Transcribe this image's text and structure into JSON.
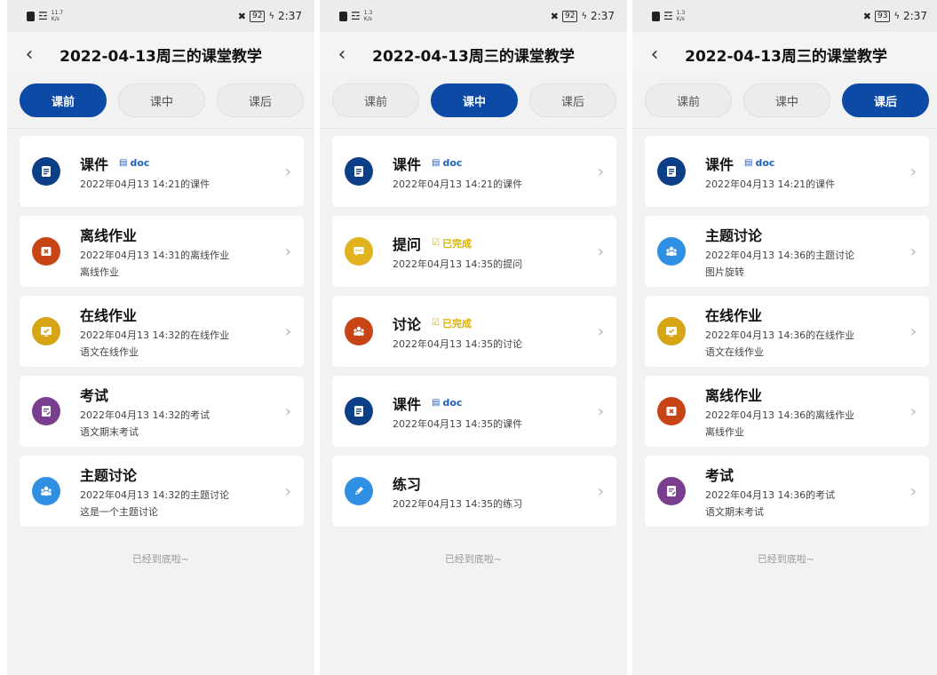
{
  "phones": [
    {
      "status": {
        "net": [
          "11.7",
          "K/s"
        ],
        "battery": "92",
        "time": "2:37"
      },
      "title": "2022-04-13周三的课堂教学",
      "tabs": [
        {
          "label": "课前",
          "active": true
        },
        {
          "label": "课中",
          "active": false
        },
        {
          "label": "课后",
          "active": false
        }
      ],
      "items": [
        {
          "title": "课件",
          "tag": "doc",
          "tag_type": "doc",
          "sub": "2022年04月13 14:21的课件",
          "sub2": "",
          "icon": "document-icon",
          "color": "#0d3f86"
        },
        {
          "title": "离线作业",
          "tag": "",
          "tag_type": "",
          "sub": "2022年04月13 14:31的离线作业",
          "sub2": "离线作业",
          "icon": "x-box-icon",
          "color": "#c74416"
        },
        {
          "title": "在线作业",
          "tag": "",
          "tag_type": "",
          "sub": "2022年04月13 14:32的在线作业",
          "sub2": "语文在线作业",
          "icon": "monitor-check-icon",
          "color": "#d7a415"
        },
        {
          "title": "考试",
          "tag": "",
          "tag_type": "",
          "sub": "2022年04月13 14:32的考试",
          "sub2": "语文期末考试",
          "icon": "exam-paper-icon",
          "color": "#7a3e8f"
        },
        {
          "title": "主题讨论",
          "tag": "",
          "tag_type": "",
          "sub": "2022年04月13 14:32的主题讨论",
          "sub2": "这是一个主题讨论",
          "icon": "people-icon",
          "color": "#2f8fe3"
        }
      ],
      "footer": "已经到底啦~"
    },
    {
      "status": {
        "net": [
          "1.3",
          "K/s"
        ],
        "battery": "92",
        "time": "2:37"
      },
      "title": "2022-04-13周三的课堂教学",
      "tabs": [
        {
          "label": "课前",
          "active": false
        },
        {
          "label": "课中",
          "active": true
        },
        {
          "label": "课后",
          "active": false
        }
      ],
      "items": [
        {
          "title": "课件",
          "tag": "doc",
          "tag_type": "doc",
          "sub": "2022年04月13 14:21的课件",
          "sub2": "",
          "icon": "document-icon",
          "color": "#0d3f86"
        },
        {
          "title": "提问",
          "tag": "已完成",
          "tag_type": "done",
          "sub": "2022年04月13 14:35的提问",
          "sub2": "",
          "icon": "chat-bubble-icon",
          "color": "#e0b21d"
        },
        {
          "title": "讨论",
          "tag": "已完成",
          "tag_type": "done",
          "sub": "2022年04月13 14:35的讨论",
          "sub2": "",
          "icon": "people-icon",
          "color": "#c74416"
        },
        {
          "title": "课件",
          "tag": "doc",
          "tag_type": "doc",
          "sub": "2022年04月13 14:35的课件",
          "sub2": "",
          "icon": "document-icon",
          "color": "#0d3f86"
        },
        {
          "title": "练习",
          "tag": "",
          "tag_type": "",
          "sub": "2022年04月13 14:35的练习",
          "sub2": "",
          "icon": "pencil-icon",
          "color": "#2f8fe3"
        }
      ],
      "footer": "已经到底啦~"
    },
    {
      "status": {
        "net": [
          "1.3",
          "K/s"
        ],
        "battery": "93",
        "time": "2:37"
      },
      "title": "2022-04-13周三的课堂教学",
      "tabs": [
        {
          "label": "课前",
          "active": false
        },
        {
          "label": "课中",
          "active": false
        },
        {
          "label": "课后",
          "active": true
        }
      ],
      "items": [
        {
          "title": "课件",
          "tag": "doc",
          "tag_type": "doc",
          "sub": "2022年04月13 14:21的课件",
          "sub2": "",
          "icon": "document-icon",
          "color": "#0d3f86"
        },
        {
          "title": "主题讨论",
          "tag": "",
          "tag_type": "",
          "sub": "2022年04月13 14:36的主题讨论",
          "sub2": "图片旋转",
          "icon": "people-icon",
          "color": "#2f8fe3"
        },
        {
          "title": "在线作业",
          "tag": "",
          "tag_type": "",
          "sub": "2022年04月13 14:36的在线作业",
          "sub2": "语文在线作业",
          "icon": "monitor-check-icon",
          "color": "#d7a415"
        },
        {
          "title": "离线作业",
          "tag": "",
          "tag_type": "",
          "sub": "2022年04月13 14:36的离线作业",
          "sub2": "离线作业",
          "icon": "x-box-icon",
          "color": "#c74416"
        },
        {
          "title": "考试",
          "tag": "",
          "tag_type": "",
          "sub": "2022年04月13 14:36的考试",
          "sub2": "语文期末考试",
          "icon": "exam-paper-icon",
          "color": "#7a3e8f"
        }
      ],
      "footer": "已经到底啦~"
    }
  ]
}
